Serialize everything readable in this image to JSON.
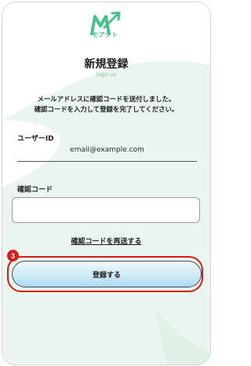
{
  "app": {
    "logo_text": "モアクト"
  },
  "page": {
    "title": "新規登録",
    "subtitle": "Sign-up",
    "message": "メールアドレスに確認コードを送付しました。\n確認コードを入力して登録を完了してください。"
  },
  "form": {
    "userid_label": "ユーザーID",
    "userid_value": "email@example.com",
    "code_label": "確認コード",
    "code_value": "",
    "resend_link": "確認コードを再送する",
    "submit_label": "登録する"
  },
  "annotation": {
    "step_number": "3"
  },
  "colors": {
    "brand_green": "#4bbf8a",
    "bg_green": "#e9f5ee",
    "highlight_red": "#d31d1d",
    "button_blue": "#cbe9f7"
  },
  "icons": {
    "logo": "moact-logo-icon"
  }
}
